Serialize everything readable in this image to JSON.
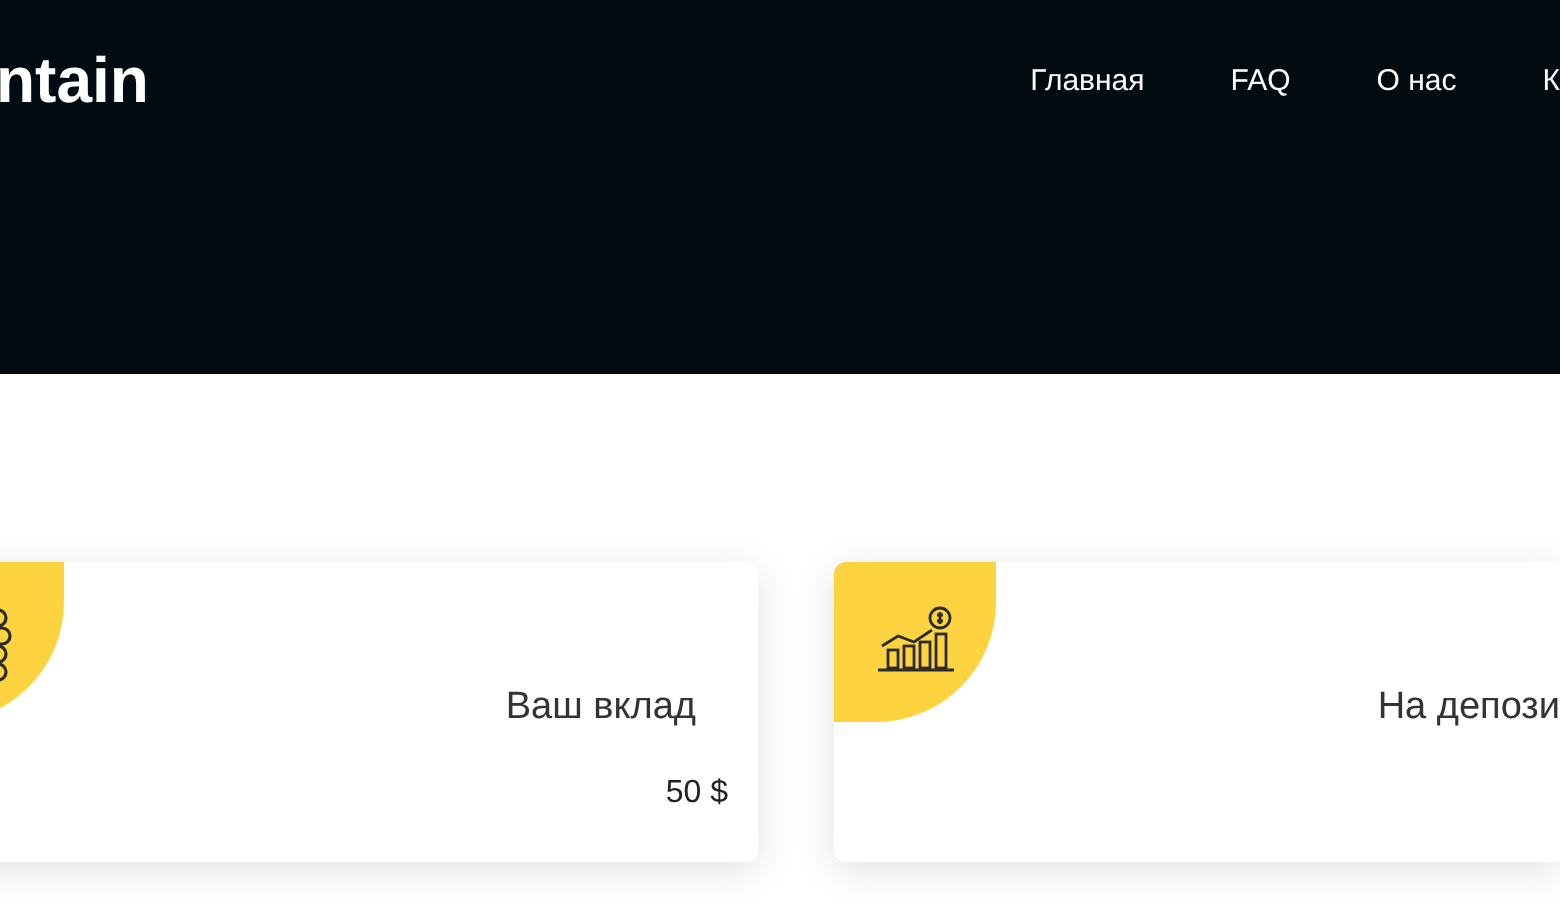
{
  "header": {
    "logo": "ntain",
    "nav": [
      {
        "label": "Главная"
      },
      {
        "label": "FAQ"
      },
      {
        "label": "О нас"
      },
      {
        "label": "К"
      }
    ]
  },
  "cards": [
    {
      "title": "Ваш вклад",
      "value": "50 $"
    },
    {
      "title": "На депози"
    }
  ]
}
